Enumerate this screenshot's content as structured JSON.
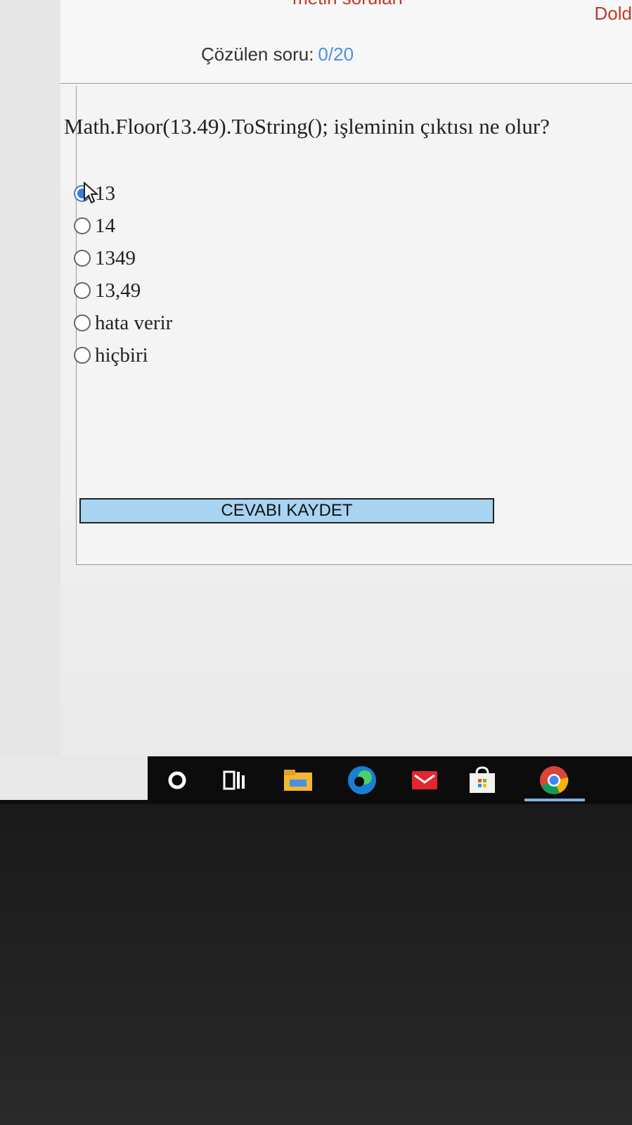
{
  "header": {
    "subtitle_partial": "metin soruları",
    "right_label_partial": "Dold",
    "counter_label": "Çözülen soru:",
    "counter_value": "0/20"
  },
  "quiz": {
    "question": "Math.Floor(13.49).ToString(); işleminin çıktısı ne olur?",
    "options": [
      {
        "label": "13",
        "selected": true
      },
      {
        "label": "14",
        "selected": false
      },
      {
        "label": "1349",
        "selected": false
      },
      {
        "label": "13,49",
        "selected": false
      },
      {
        "label": "hata verir",
        "selected": false
      },
      {
        "label": "hiçbiri",
        "selected": false
      }
    ],
    "save_label": "CEVABI KAYDET"
  },
  "taskbar": {
    "icons": [
      "search-circle-icon",
      "task-view-icon",
      "file-explorer-icon",
      "edge-icon",
      "mail-icon",
      "store-icon",
      "chrome-icon"
    ],
    "active": "chrome-icon"
  },
  "colors": {
    "accent_red": "#c0392b",
    "counter_blue": "#4a90e2",
    "button_blue": "#a8d4f2",
    "radio_checked": "#3a7bd5"
  }
}
